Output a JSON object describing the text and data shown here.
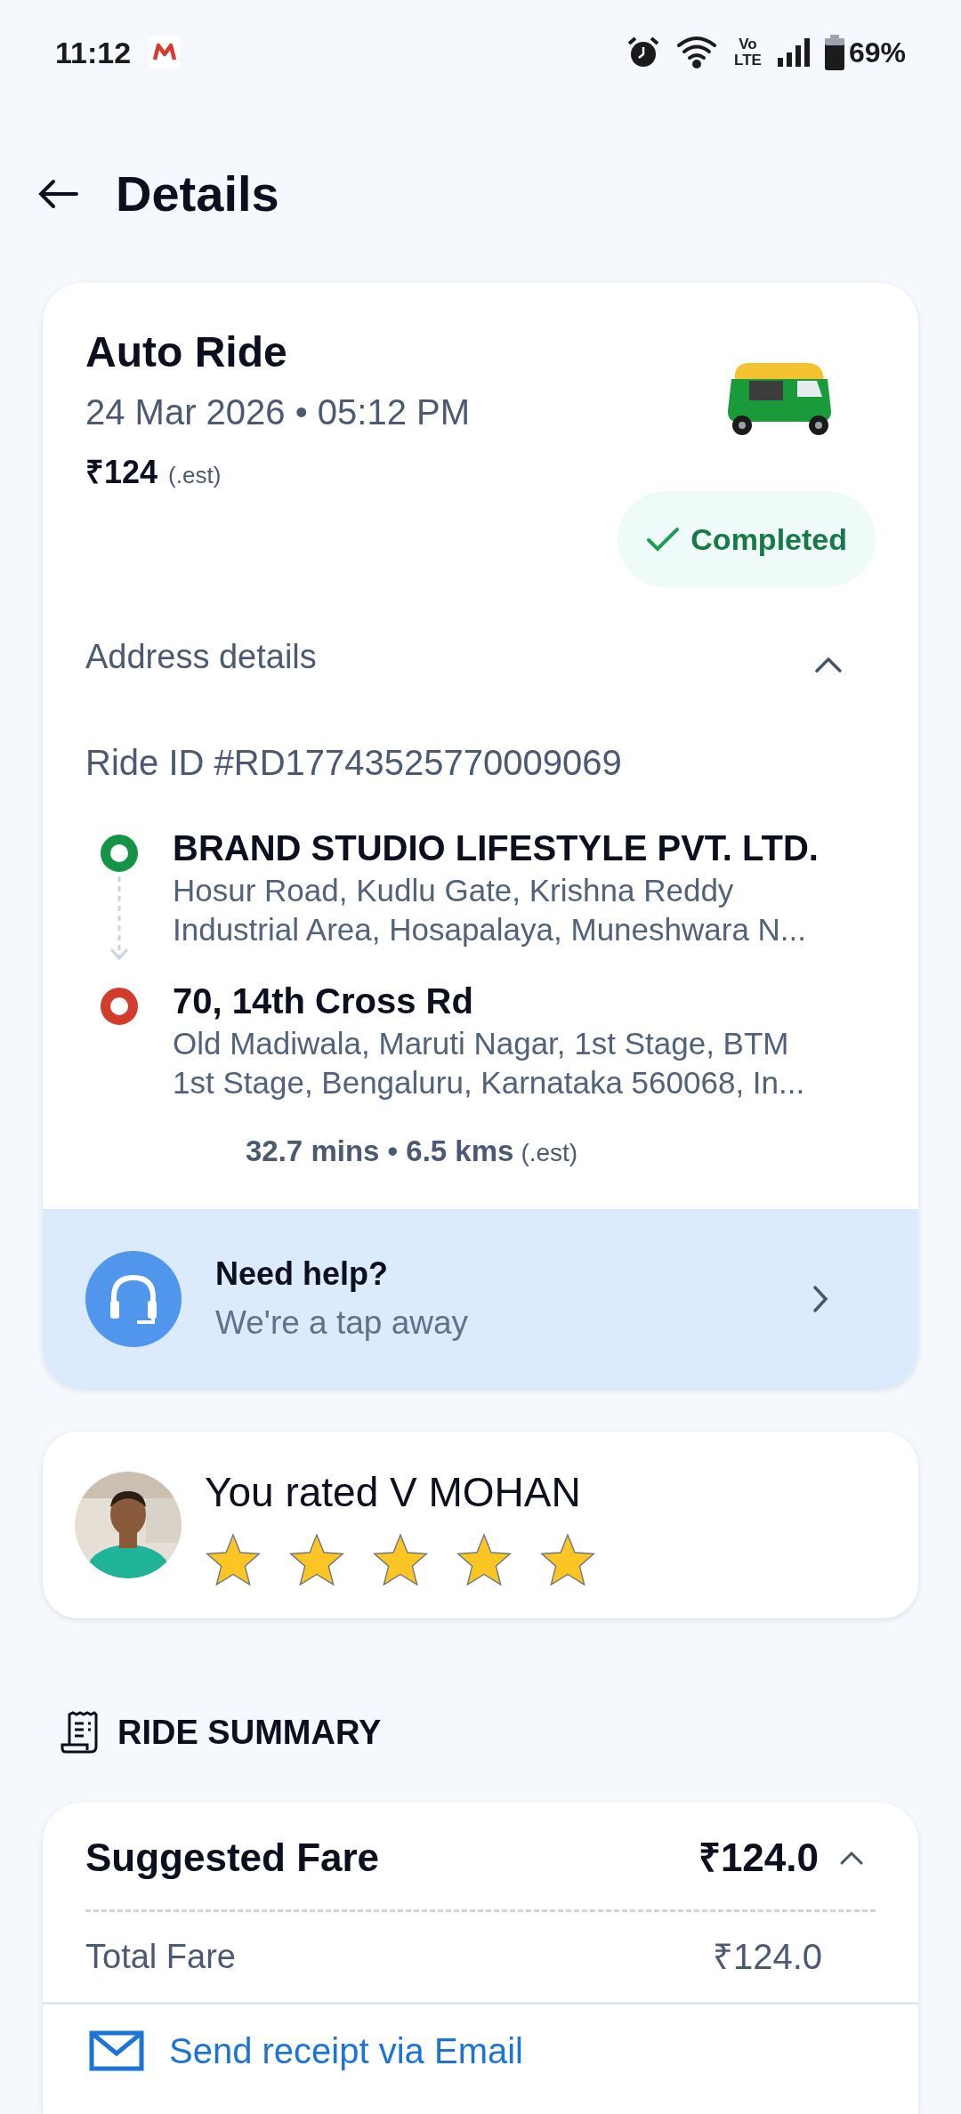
{
  "status_bar": {
    "time": "11:12",
    "network_label": [
      "Vo",
      "LTE"
    ],
    "battery": "69%"
  },
  "header": {
    "title": "Details"
  },
  "ride": {
    "title": "Auto Ride",
    "datetime": "24 Mar 2026 • 05:12 PM",
    "fare": "₹124",
    "fare_note": "(.est)",
    "status": {
      "label": "Completed",
      "kind": "completed"
    },
    "address_section": {
      "label": "Address details",
      "expanded": true
    },
    "ride_id": "Ride ID #RD17743525770009069",
    "stops": [
      {
        "kind": "pickup",
        "name": "BRAND STUDIO LIFESTYLE PVT. LTD.",
        "address": [
          "Hosur Road, Kudlu Gate, Krishna Reddy",
          "Industrial Area, Hosapalaya, Muneshwara N..."
        ]
      },
      {
        "kind": "drop",
        "name": "70, 14th Cross Rd",
        "address": [
          "Old Madiwala, Maruti Nagar, 1st Stage, BTM",
          "1st Stage, Bengaluru, Karnataka 560068, In..."
        ]
      }
    ],
    "trip": "32.7 mins • 6.5 kms",
    "trip_note": "(.est)"
  },
  "help": {
    "title": "Need help?",
    "subtitle": "We're a tap away"
  },
  "rating": {
    "label": "You rated V MOHAN",
    "stars": 5
  },
  "summary": {
    "heading": "RIDE SUMMARY",
    "fare_title": "Suggested Fare",
    "fare_value": "₹124.0",
    "expanded": true,
    "rows": [
      {
        "label": "Total Fare",
        "value": "₹124.0"
      }
    ],
    "email_link": "Send receipt via Email"
  }
}
